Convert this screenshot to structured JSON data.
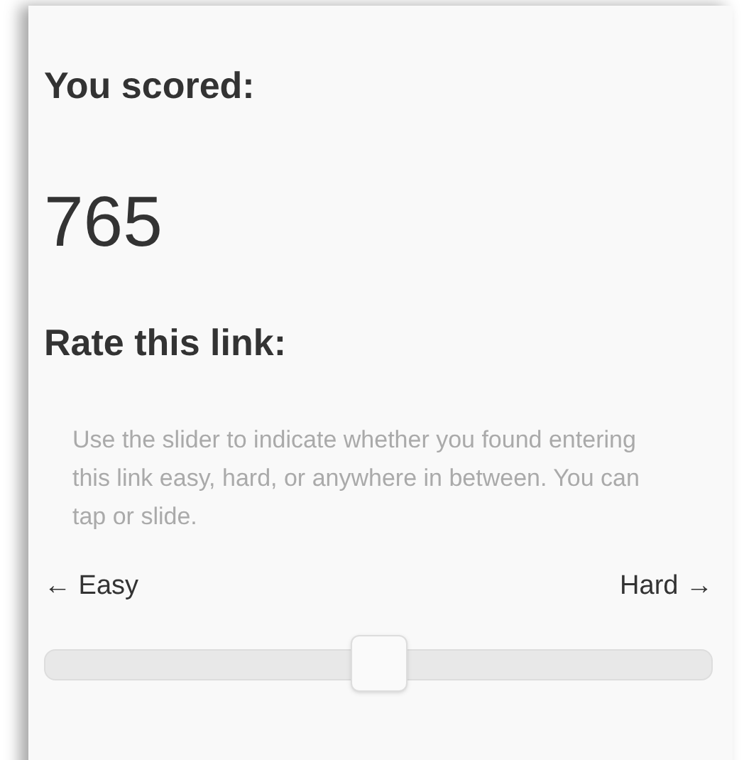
{
  "score_heading": "You scored:",
  "score": "765",
  "rate_heading": "Rate this link:",
  "instructions": "Use the slider to indicate whether you found entering this link easy, hard, or anywhere in between. You can tap or slide.",
  "slider": {
    "min_label": "← Easy",
    "max_label": "Hard →",
    "level": 0.5
  }
}
